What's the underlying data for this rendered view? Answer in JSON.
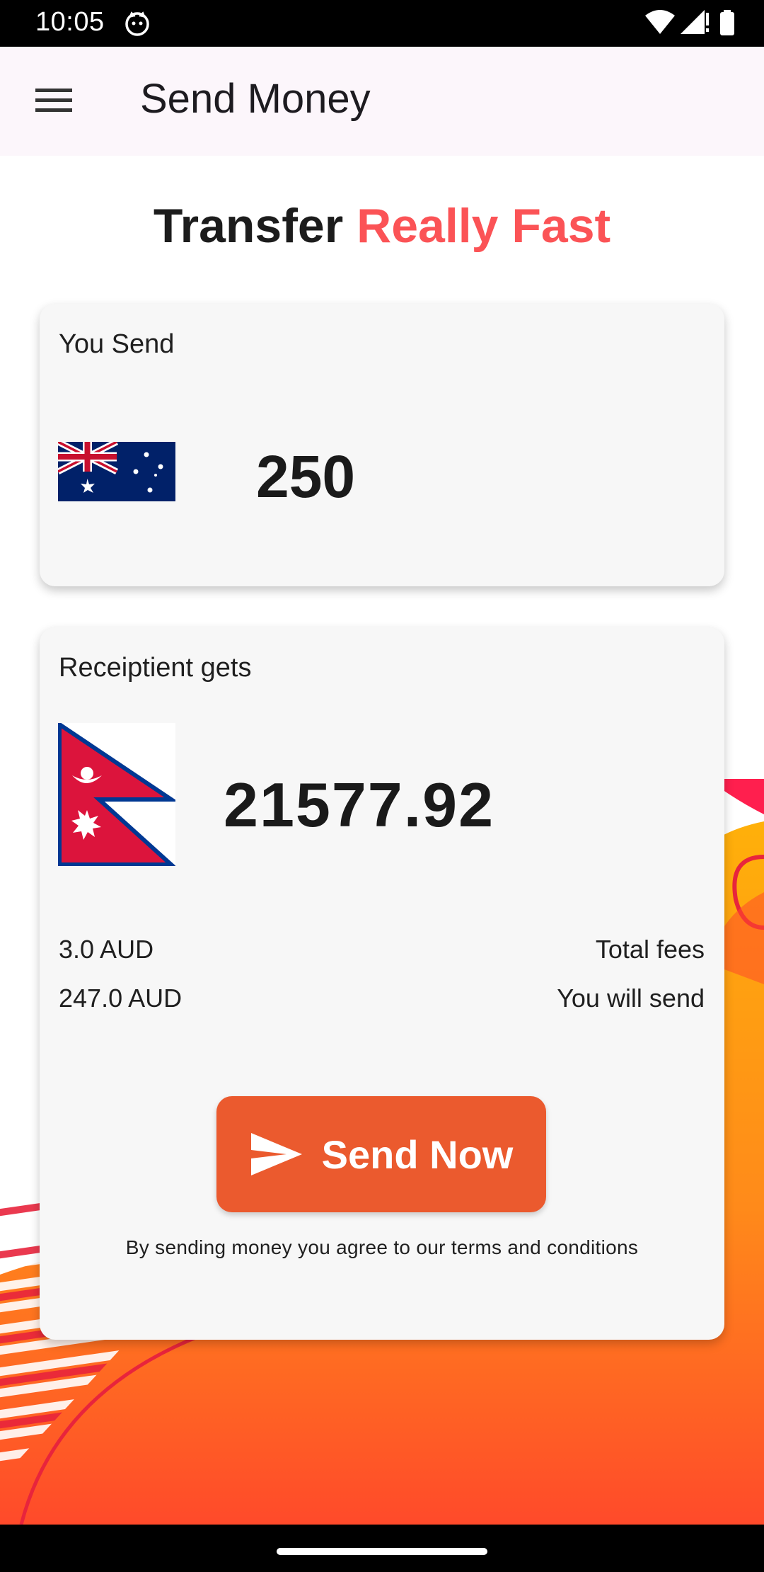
{
  "status_bar": {
    "time": "10:05",
    "icons": [
      "cat-icon",
      "wifi-icon",
      "signal-icon",
      "battery-icon"
    ]
  },
  "app_bar": {
    "title": "Send Money",
    "menu_icon": "menu-icon"
  },
  "headline": {
    "part1": "Transfer",
    "part2": "Really Fast",
    "accent_color": "#fb5356"
  },
  "send_card": {
    "label": "You Send",
    "flag": "australia-flag",
    "amount": "250"
  },
  "receive_card": {
    "label": "Receiptient gets",
    "flag": "nepal-flag",
    "amount": "21577.92",
    "fees_value": "3.0 AUD",
    "fees_label": "Total fees",
    "send_value": "247.0 AUD",
    "send_label": "You will send",
    "button_label": "Send Now",
    "button_color": "#eb5a2e",
    "terms": "By sending money you agree to our terms and conditions"
  }
}
